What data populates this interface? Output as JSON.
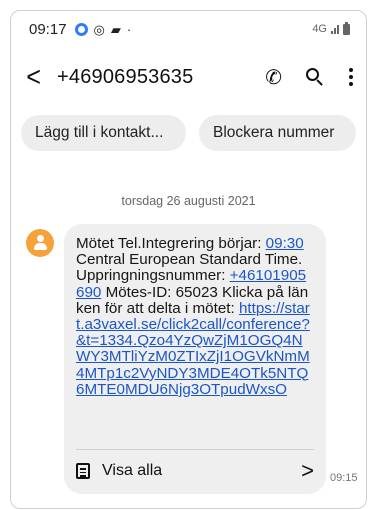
{
  "status_bar": {
    "time": "09:17",
    "network": "4G",
    "icons": [
      "notification-icon",
      "circle-icon",
      "lock-icon",
      "dot-icon",
      "signal-icon",
      "battery-icon"
    ]
  },
  "header": {
    "phone_number": "+46906953635",
    "actions": [
      "call-icon",
      "search-icon",
      "more-icon"
    ]
  },
  "chips": [
    {
      "label": "Lägg till i kontakt..."
    },
    {
      "label": "Blockera nummer"
    }
  ],
  "conversation": {
    "date": "torsdag 26 augusti 2021",
    "message": {
      "p1": "Mötet Tel.Integrering börjar: ",
      "time_link": "09:30",
      "p2": " Central European Standard Time. Uppringningsnummer: ",
      "phone_link": "+46101905690",
      "p3": " Mötes-ID: 65023 Klicka på länken för att delta i mötet: ",
      "url_link": "https://start.a3vaxel.se/click2call/conference?&t=1334.Qzo4YzQwZjM1OGQ4NWY3MTliYzM0ZTIxZjI1OGVkNmM4MTp1c2VyNDY3MDE4OTk5NTQ6MTE0MDU6Njg3OTpudWxsO"
    },
    "view_all_label": "Visa alla",
    "sent_time": "09:15"
  },
  "colors": {
    "link": "#1b56c9",
    "avatar": "#f5a23a",
    "bubble": "#efefef",
    "chip": "#ededed"
  }
}
